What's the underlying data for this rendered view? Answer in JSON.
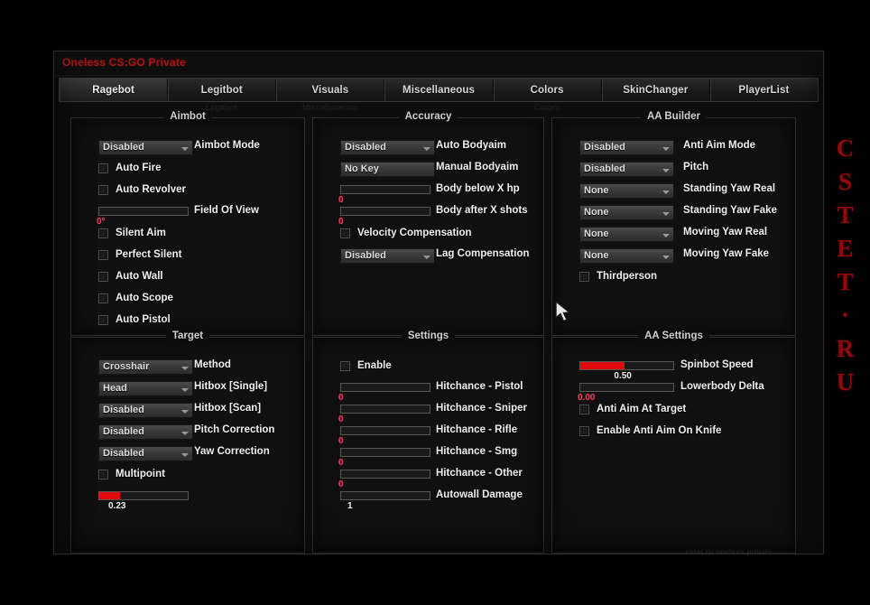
{
  "window": {
    "title": "Oneless CS:GO Private"
  },
  "tabs": [
    {
      "label": "Ragebot",
      "active": true
    },
    {
      "label": "Legitbot",
      "active": false
    },
    {
      "label": "Visuals",
      "active": false
    },
    {
      "label": "Miscellaneous",
      "active": false
    },
    {
      "label": "Colors",
      "active": false
    },
    {
      "label": "SkinChanger",
      "active": false
    },
    {
      "label": "PlayerList",
      "active": false
    }
  ],
  "ghost_row": [
    "",
    "Legitbot",
    "Miscellaneous",
    "",
    "Colors",
    "",
    ""
  ],
  "groups": {
    "aimbot": {
      "title": "Aimbot",
      "rows": [
        {
          "kind": "combo",
          "value": "Disabled",
          "label": "Aimbot Mode"
        },
        {
          "kind": "checkbox",
          "label": "Auto Fire",
          "checked": false
        },
        {
          "kind": "checkbox",
          "label": "Auto Revolver",
          "checked": false
        },
        {
          "kind": "slider",
          "label": "Field Of View",
          "value": "0°",
          "percent": 0,
          "value_color": "red"
        },
        {
          "kind": "checkbox",
          "label": "Silent Aim",
          "checked": false
        },
        {
          "kind": "checkbox",
          "label": "Perfect Silent",
          "checked": false
        },
        {
          "kind": "checkbox",
          "label": "Auto Wall",
          "checked": false
        },
        {
          "kind": "checkbox",
          "label": "Auto Scope",
          "checked": false
        },
        {
          "kind": "checkbox",
          "label": "Auto Pistol",
          "checked": false
        }
      ]
    },
    "accuracy": {
      "title": "Accuracy",
      "rows": [
        {
          "kind": "combo",
          "value": "Disabled",
          "label": "Auto Bodyaim"
        },
        {
          "kind": "keybind",
          "value": "No Key",
          "label": "Manual Bodyaim"
        },
        {
          "kind": "slider",
          "label": "Body below X hp",
          "value": "0",
          "percent": 0,
          "value_color": "red"
        },
        {
          "kind": "slider",
          "label": "Body after X shots",
          "value": "0",
          "percent": 0,
          "value_color": "red"
        },
        {
          "kind": "checkbox",
          "label": "Velocity Compensation",
          "checked": false
        },
        {
          "kind": "combo",
          "value": "Disabled",
          "label": "Lag Compensation"
        }
      ]
    },
    "aa_builder": {
      "title": "AA Builder",
      "rows": [
        {
          "kind": "combo",
          "value": "Disabled",
          "label": "Anti Aim Mode"
        },
        {
          "kind": "combo",
          "value": "Disabled",
          "label": "Pitch"
        },
        {
          "kind": "combo",
          "value": "None",
          "label": "Standing Yaw Real"
        },
        {
          "kind": "combo",
          "value": "None",
          "label": "Standing Yaw Fake"
        },
        {
          "kind": "combo",
          "value": "None",
          "label": "Moving Yaw Real"
        },
        {
          "kind": "combo",
          "value": "None",
          "label": "Moving Yaw Fake"
        },
        {
          "kind": "checkbox",
          "label": "Thirdperson",
          "checked": false
        }
      ]
    },
    "target": {
      "title": "Target",
      "rows": [
        {
          "kind": "combo",
          "value": "Crosshair",
          "label": "Method"
        },
        {
          "kind": "combo",
          "value": "Head",
          "label": "Hitbox [Single]"
        },
        {
          "kind": "combo",
          "value": "Disabled",
          "label": "Hitbox [Scan]"
        },
        {
          "kind": "combo",
          "value": "Disabled",
          "label": "Pitch Correction"
        },
        {
          "kind": "combo",
          "value": "Disabled",
          "label": "Yaw Correction"
        },
        {
          "kind": "checkbox",
          "label": "Multipoint",
          "checked": false
        },
        {
          "kind": "slider",
          "label": "",
          "value": "0.23",
          "percent": 23,
          "value_color": "white"
        }
      ]
    },
    "settings": {
      "title": "Settings",
      "rows": [
        {
          "kind": "checkbox",
          "label": "Enable",
          "checked": false
        },
        {
          "kind": "slider",
          "label": "Hitchance - Pistol",
          "value": "0",
          "percent": 0,
          "value_color": "red"
        },
        {
          "kind": "slider",
          "label": "Hitchance - Sniper",
          "value": "0",
          "percent": 0,
          "value_color": "red"
        },
        {
          "kind": "slider",
          "label": "Hitchance - Rifle",
          "value": "0",
          "percent": 0,
          "value_color": "red"
        },
        {
          "kind": "slider",
          "label": "Hitchance - Smg",
          "value": "0",
          "percent": 0,
          "value_color": "red"
        },
        {
          "kind": "slider",
          "label": "Hitchance - Other",
          "value": "0",
          "percent": 0,
          "value_color": "red"
        },
        {
          "kind": "slider",
          "label": "Autowall Damage",
          "value": "1",
          "percent": 0,
          "value_color": "white"
        }
      ]
    },
    "aa_settings": {
      "title": "AA Settings",
      "rows": [
        {
          "kind": "slider",
          "label": "Spinbot Speed",
          "value": "0.50",
          "percent": 48,
          "value_color": "white"
        },
        {
          "kind": "slider",
          "label": "Lowerbody Delta",
          "value": "0.00",
          "percent": 0,
          "value_color": "red"
        },
        {
          "kind": "checkbox",
          "label": "Anti Aim At Target",
          "checked": false
        },
        {
          "kind": "checkbox",
          "label": "Enable Anti Aim On Knife",
          "checked": false
        }
      ]
    }
  },
  "side_brand": [
    "C",
    "S",
    "T",
    "E",
    "T",
    "·",
    "R",
    "U"
  ],
  "bottom_watermark": "cstet.ru  oneless private",
  "colors": {
    "accent_red": "#e00c0c",
    "title_red": "#c21b1b",
    "brand_red": "#8f0b0b",
    "value_red": "#e1415c",
    "text": "#efefef",
    "window_bg": "#0d0d0d"
  }
}
